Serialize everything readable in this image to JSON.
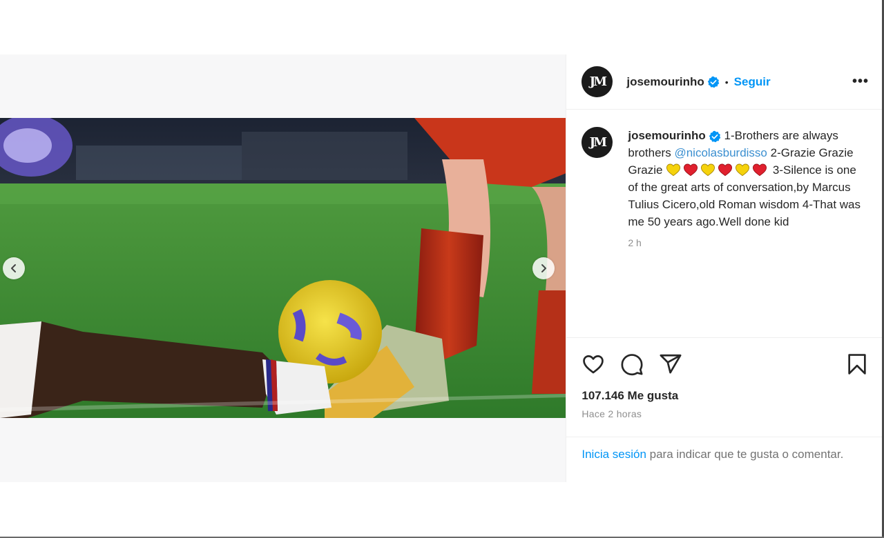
{
  "post": {
    "username": "josemourinho",
    "avatar_text": "JM",
    "follow_label": "Seguir",
    "separator": "•",
    "more_label": "•••",
    "caption": {
      "part1": "1-Brothers are always brothers ",
      "mention": "@nicolasburdisso",
      "part2": " 2-Grazie Grazie Grazie ",
      "part3": " 3-Silence is one of the great arts of conversation,by Marcus Tulius Cicero,old Roman wisdom 4-That was me 50 years ago.Well done kid"
    },
    "emoji_sequence": [
      "yellow-heart",
      "red-heart",
      "yellow-heart",
      "red-heart",
      "yellow-heart",
      "red-heart"
    ],
    "caption_time": "2 h",
    "likes": "107.146 Me gusta",
    "posted_ago": "Hace 2 horas",
    "login": {
      "link": "Inicia sesión",
      "rest": " para indicar que te gusta o comentar."
    },
    "carousel": {
      "slides": 3,
      "active": 2
    },
    "colors": {
      "accent": "#0095f6",
      "verified": "#0095f6",
      "red_heart": "#e0202e",
      "yellow_heart": "#f5d20c"
    }
  }
}
